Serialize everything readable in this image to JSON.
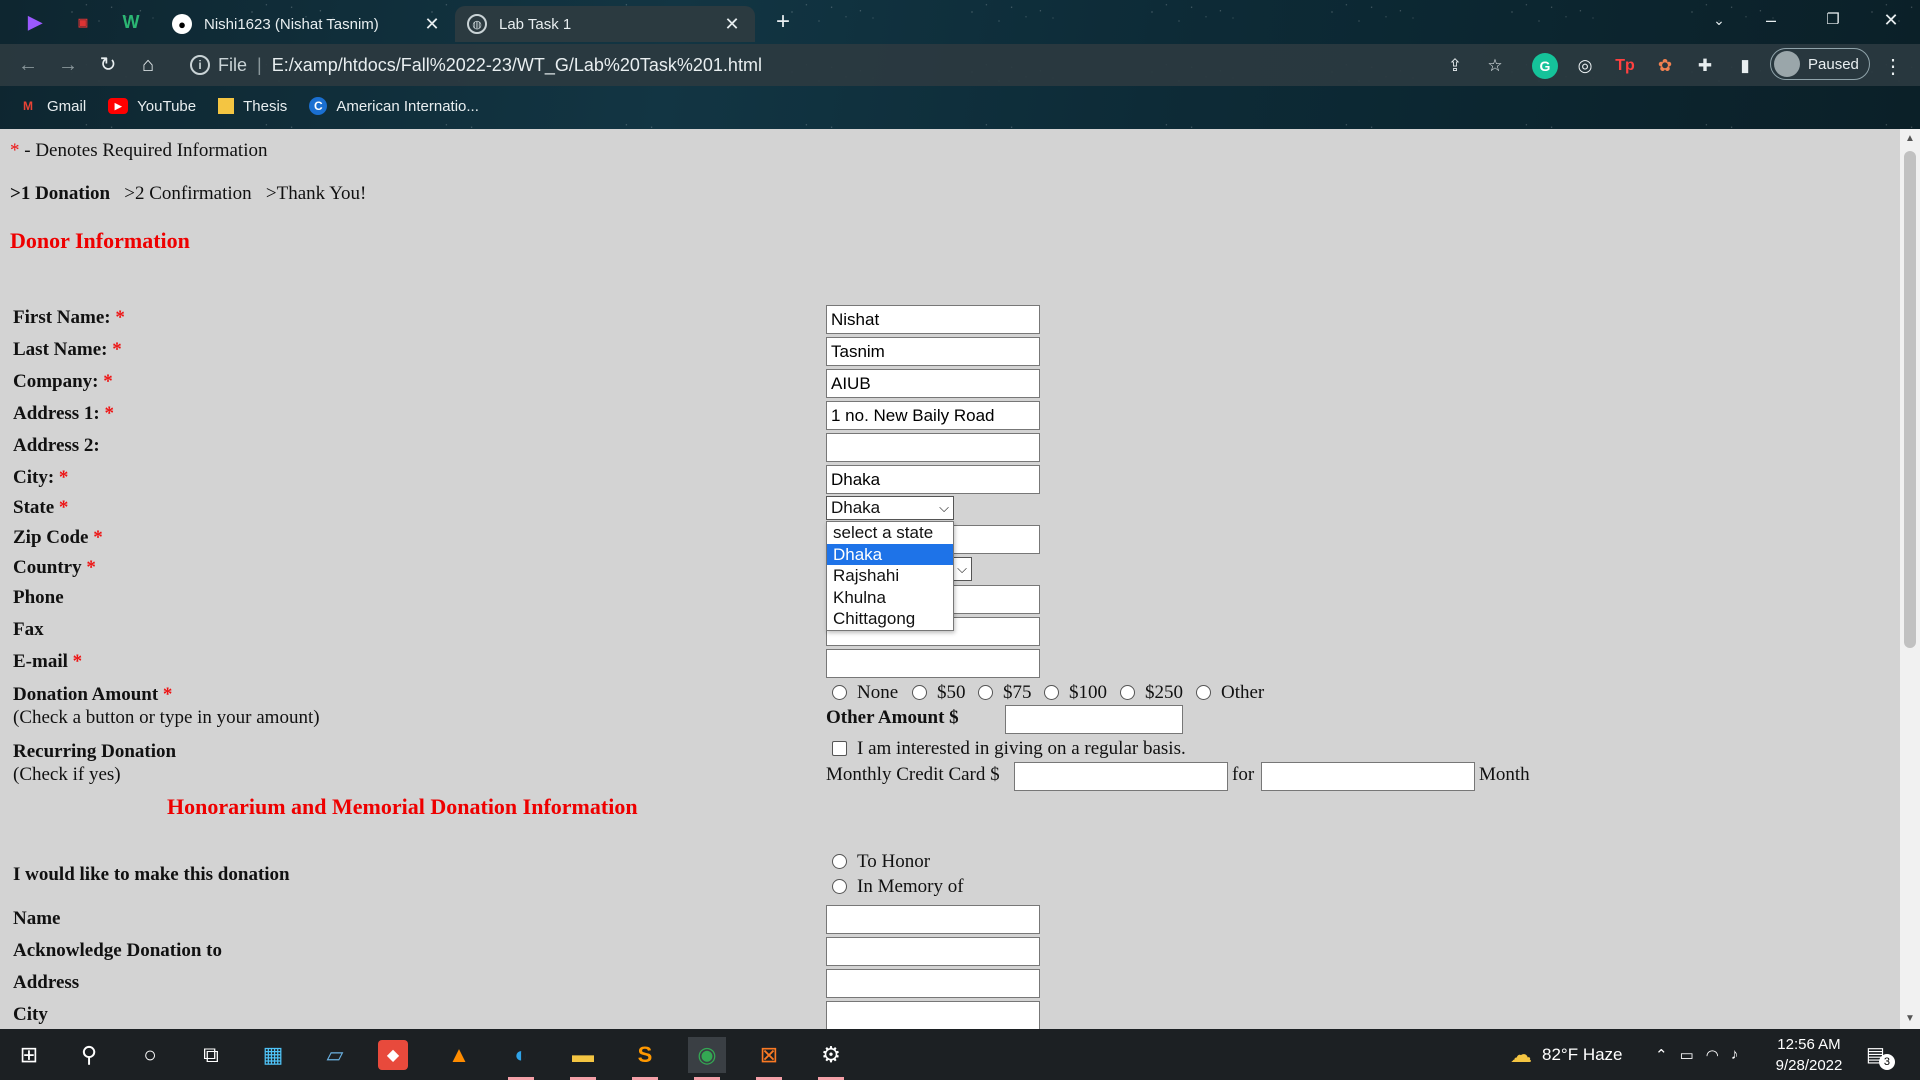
{
  "browser": {
    "tabs": [
      {
        "title": "Nishi1623 (Nishat Tasnim)",
        "active": false
      },
      {
        "title": "Lab Task 1",
        "active": true
      }
    ],
    "address": {
      "scheme": "File",
      "url": "E:/xamp/htdocs/Fall%2022-23/WT_G/Lab%20Task%201.html"
    },
    "profile_status": "Paused",
    "bookmarks": [
      "Gmail",
      "YouTube",
      "Thesis",
      "American Internatio..."
    ]
  },
  "page": {
    "required_note": "- Denotes Required Information",
    "required_mark": "*",
    "steps": [
      ">1 Donation",
      ">2 Confirmation",
      ">Thank You!"
    ],
    "section_donor": "Donor Information",
    "labels": {
      "first_name": "First Name:",
      "last_name": "Last Name:",
      "company": "Company:",
      "address1": "Address 1:",
      "address2": "Address 2:",
      "city": "City:",
      "state": "State",
      "zip": "Zip Code",
      "country": "Country",
      "phone": "Phone",
      "fax": "Fax",
      "email": "E-mail",
      "donation_amount": "Donation Amount",
      "donation_hint": "(Check a button or type in your amount)",
      "recurring": "Recurring Donation",
      "recurring_hint": "(Check if yes)"
    },
    "values": {
      "first_name": "Nishat",
      "last_name": "Tasnim",
      "company": "AIUB",
      "address1": "1 no. New Baily Road",
      "address2": "",
      "city": "Dhaka",
      "state_selected": "Dhaka"
    },
    "state_options": [
      "select a state",
      "Dhaka",
      "Rajshahi",
      "Khulna",
      "Chittagong"
    ],
    "amount_options": [
      "None",
      "$50",
      "$75",
      "$100",
      "$250",
      "Other"
    ],
    "other_amount_label": "Other Amount $",
    "recurring_text": "I am interested in giving on a regular basis.",
    "monthly_label": "Monthly Credit Card $",
    "for_label": "for",
    "month_label": "Month",
    "section_honorarium": "Honorarium and Memorial Donation Information",
    "honor_labels": {
      "make_donation": "I would like to make this donation",
      "name": "Name",
      "acknowledge": "Acknowledge Donation to",
      "address": "Address",
      "city": "City"
    },
    "honor_options": [
      "To Honor",
      "In Memory of"
    ]
  },
  "taskbar": {
    "weather": "82°F Haze",
    "time": "12:56 AM",
    "date": "9/28/2022",
    "notifications": "3"
  }
}
